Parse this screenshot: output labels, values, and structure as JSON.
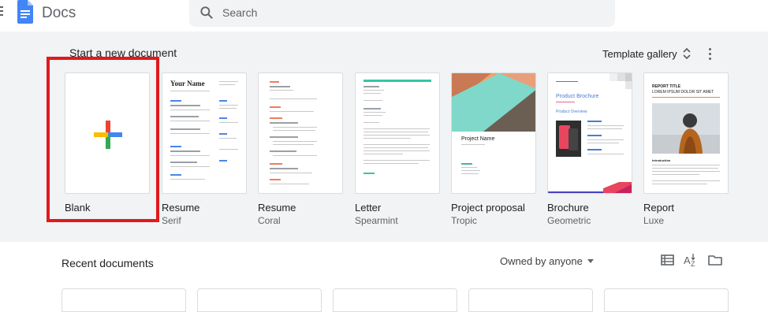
{
  "header": {
    "app_title": "Docs",
    "search_placeholder": "Search"
  },
  "templates_section": {
    "heading": "Start a new document",
    "gallery_label": "Template gallery",
    "templates": [
      {
        "name": "Blank",
        "subtitle": ""
      },
      {
        "name": "Resume",
        "subtitle": "Serif",
        "thumb_heading": "Your Name"
      },
      {
        "name": "Resume",
        "subtitle": "Coral"
      },
      {
        "name": "Letter",
        "subtitle": "Spearmint"
      },
      {
        "name": "Project proposal",
        "subtitle": "Tropic",
        "thumb_heading": "Project Name"
      },
      {
        "name": "Brochure",
        "subtitle": "Geometric",
        "thumb_heading": "Product Brochure",
        "thumb_sub": "Product Overview"
      },
      {
        "name": "Report",
        "subtitle": "Luxe",
        "thumb_heading": "REPORT TITLE",
        "thumb_sub": "LOREM IPSUM DOLOR SIT AMET",
        "thumb_intro": "Introduction"
      }
    ]
  },
  "recent_section": {
    "heading": "Recent documents",
    "owner_filter": "Owned by anyone"
  },
  "colors": {
    "accent_blue": "#4285f4",
    "highlight_red": "#e0191c",
    "spearmint": "#34c6a4",
    "coral": "#f27c5a"
  }
}
